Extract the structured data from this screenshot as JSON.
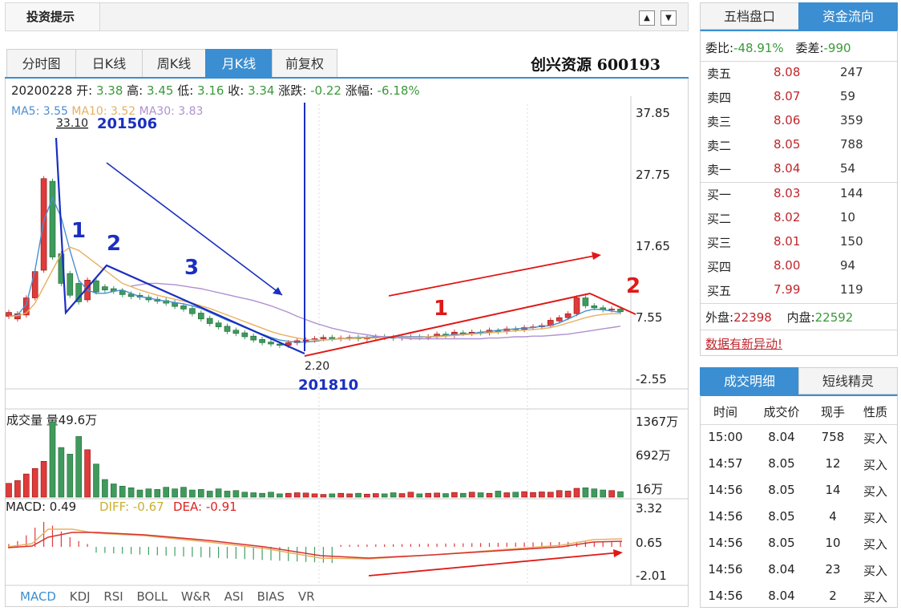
{
  "topbar": {
    "title": "投资提示",
    "up_icon": "▲",
    "down_icon": "▼"
  },
  "tabs": [
    "分时图",
    "日K线",
    "周K线",
    "月K线",
    "前复权"
  ],
  "active_tab": "月K线",
  "stock": {
    "name": "创兴资源 600193"
  },
  "info": {
    "date": "20200228",
    "open_label": "开:",
    "open": "3.38",
    "high_label": "高:",
    "high": "3.45",
    "low_label": "低:",
    "low": "3.16",
    "close_label": "收:",
    "close": "3.34",
    "change_label": "涨跌:",
    "change": "-0.22",
    "pct_label": "涨幅:",
    "pct": "-6.18%"
  },
  "ma": {
    "ma5": "MA5: 3.55",
    "ma10": "MA10: 3.52",
    "ma30": "MA30: 3.83"
  },
  "colors": {
    "accent": "#3b8ed1",
    "up": "#e03a3a",
    "down": "#3f9a5c",
    "ma5": "#4a8fd0",
    "ma10": "#e8b060",
    "ma30": "#b090d0",
    "annot_blue": "#1a2fc0",
    "annot_red": "#e01818"
  },
  "chart_data": [
    {
      "type": "candlestick",
      "title": "",
      "price_axis_ticks": [
        "37.85",
        "27.75",
        "17.65",
        "7.55",
        "-2.55"
      ],
      "ylim": [
        -2.55,
        37.85
      ],
      "series": [
        {
          "name": "MA5",
          "values": [
            7.0,
            7.2,
            8.8,
            14.0,
            21.5,
            25.0,
            22.0,
            17.0,
            12.5,
            11.0,
            10.5,
            10.5,
            10.8,
            11.0,
            10.5,
            10.0,
            9.8,
            9.5,
            9.3,
            9.1,
            8.9,
            8.6,
            8.2,
            7.6,
            7.0,
            6.4,
            5.9,
            5.3,
            4.8,
            4.3,
            3.8,
            3.4,
            3.2,
            3.1,
            3.1,
            3.2,
            3.4,
            3.5,
            3.6,
            3.7,
            3.8,
            3.8,
            3.9,
            3.9,
            3.9,
            3.9,
            3.9,
            3.9,
            3.9,
            4.0,
            4.1,
            4.2,
            4.3,
            4.4,
            4.6,
            4.7,
            4.9,
            5.0,
            5.1,
            5.2,
            5.3,
            5.5,
            5.6,
            6.0,
            6.6,
            7.2,
            7.8,
            8.1,
            8.0,
            7.8,
            7.6
          ]
        },
        {
          "name": "MA10",
          "values": [
            7.0,
            7.1,
            7.5,
            9.0,
            11.5,
            14.0,
            16.5,
            17.5,
            17.0,
            16.0,
            15.0,
            14.0,
            13.0,
            12.0,
            11.5,
            11.0,
            10.6,
            10.2,
            9.9,
            9.6,
            9.3,
            9.0,
            8.6,
            8.2,
            7.7,
            7.2,
            6.7,
            6.2,
            5.7,
            5.2,
            4.7,
            4.3,
            4.0,
            3.7,
            3.5,
            3.4,
            3.4,
            3.5,
            3.6,
            3.6,
            3.7,
            3.7,
            3.7,
            3.8,
            3.8,
            3.8,
            3.8,
            3.8,
            3.9,
            3.9,
            4.0,
            4.1,
            4.2,
            4.3,
            4.4,
            4.5,
            4.6,
            4.7,
            4.8,
            4.9,
            5.0,
            5.1,
            5.3,
            5.6,
            6.0,
            6.4,
            6.8,
            7.1,
            7.3,
            7.4,
            7.4
          ]
        },
        {
          "name": "MA30",
          "values": [
            null,
            null,
            null,
            null,
            null,
            null,
            null,
            null,
            null,
            null,
            null,
            null,
            null,
            null,
            11.6,
            11.8,
            12.0,
            12.0,
            11.9,
            11.8,
            11.6,
            11.4,
            11.2,
            10.9,
            10.6,
            10.3,
            10.0,
            9.7,
            9.4,
            9.0,
            8.6,
            8.1,
            7.6,
            7.0,
            6.5,
            6.0,
            5.6,
            5.2,
            4.9,
            4.6,
            4.4,
            4.2,
            4.0,
            3.9,
            3.8,
            3.7,
            3.6,
            3.6,
            3.6,
            3.6,
            3.6,
            3.6,
            3.6,
            3.6,
            3.6,
            3.7,
            3.7,
            3.8,
            3.9,
            3.9,
            4.0,
            4.0,
            4.1,
            4.2,
            4.3,
            4.5,
            4.7,
            4.9,
            5.1,
            5.3,
            5.5
          ]
        }
      ],
      "annotations": [
        "33.10",
        "201506",
        "2.20",
        "201810",
        "1",
        "2",
        "3"
      ],
      "red_annotations": [
        "1",
        "2"
      ]
    },
    {
      "type": "bar",
      "title": "成交量 量49.6万",
      "ticks": [
        "1367万",
        "692万",
        "16万"
      ],
      "ylim": [
        0,
        1367
      ]
    },
    {
      "type": "bar+line",
      "title": "MACD: 0.49",
      "diff": "DIFF: -0.67",
      "dea": "DEA: -0.91",
      "ticks": [
        "3.32",
        "0.65",
        "-2.01"
      ],
      "ylim": [
        -2.01,
        3.32
      ]
    }
  ],
  "indicators": [
    "MACD",
    "KDJ",
    "RSI",
    "BOLL",
    "W&R",
    "ASI",
    "BIAS",
    "VR"
  ],
  "right_tabs": {
    "book": "五档盘口",
    "flow": "资金流向",
    "detail": "成交明细",
    "spirit": "短线精灵"
  },
  "book": {
    "wei_bi_label": "委比:",
    "wei_bi": "-48.91%",
    "wei_cha_label": "委差:",
    "wei_cha": "-990",
    "sells": [
      {
        "label": "卖五",
        "price": "8.08",
        "vol": "247"
      },
      {
        "label": "卖四",
        "price": "8.07",
        "vol": "59"
      },
      {
        "label": "卖三",
        "price": "8.06",
        "vol": "359"
      },
      {
        "label": "卖二",
        "price": "8.05",
        "vol": "788"
      },
      {
        "label": "卖一",
        "price": "8.04",
        "vol": "54"
      }
    ],
    "buys": [
      {
        "label": "买一",
        "price": "8.03",
        "vol": "144"
      },
      {
        "label": "买二",
        "price": "8.02",
        "vol": "10"
      },
      {
        "label": "买三",
        "price": "8.01",
        "vol": "150"
      },
      {
        "label": "买四",
        "price": "8.00",
        "vol": "94"
      },
      {
        "label": "买五",
        "price": "7.99",
        "vol": "119"
      }
    ],
    "wai_label": "外盘:",
    "wai": "22398",
    "nei_label": "内盘:",
    "nei": "22592",
    "alert": "数据有新异动!"
  },
  "trades": {
    "headers": [
      "时间",
      "成交价",
      "现手",
      "性质"
    ],
    "rows": [
      [
        "15:00",
        "8.04",
        "758",
        "买入"
      ],
      [
        "14:57",
        "8.05",
        "12",
        "买入"
      ],
      [
        "14:56",
        "8.05",
        "14",
        "买入"
      ],
      [
        "14:56",
        "8.05",
        "4",
        "买入"
      ],
      [
        "14:56",
        "8.05",
        "10",
        "买入"
      ],
      [
        "14:56",
        "8.04",
        "23",
        "买入"
      ],
      [
        "14:56",
        "8.04",
        "2",
        "买入"
      ]
    ]
  }
}
